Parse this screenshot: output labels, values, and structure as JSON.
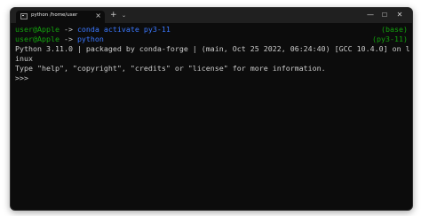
{
  "tab": {
    "title": "python /home/user",
    "close_glyph": "×",
    "new_tab_glyph": "+",
    "dropdown_glyph": "⌄",
    "icon": "terminal-icon"
  },
  "window_controls": {
    "minimize": "—",
    "maximize": "☐",
    "close": "✕"
  },
  "terminal": {
    "line1": {
      "user": "user@Apple",
      "arrow": " -> ",
      "command": "conda activate py3-11",
      "env": "(base)"
    },
    "line2": {
      "user": "user@Apple",
      "arrow": " -> ",
      "command": "python",
      "env": "(py3-11)"
    },
    "line3": "Python 3.11.0 | packaged by conda-forge | (main, Oct 25 2022, 06:24:40) [GCC 10.4.0] on l",
    "line4": "inux",
    "line5": "Type \"help\", \"copyright\", \"credits\" or \"license\" for more information.",
    "prompt": ">>>"
  },
  "colors": {
    "background": "#0c0c0c",
    "titlebar": "#202020",
    "user_green": "#13a10e",
    "command_blue": "#3b78ff",
    "text": "#cccccc"
  }
}
